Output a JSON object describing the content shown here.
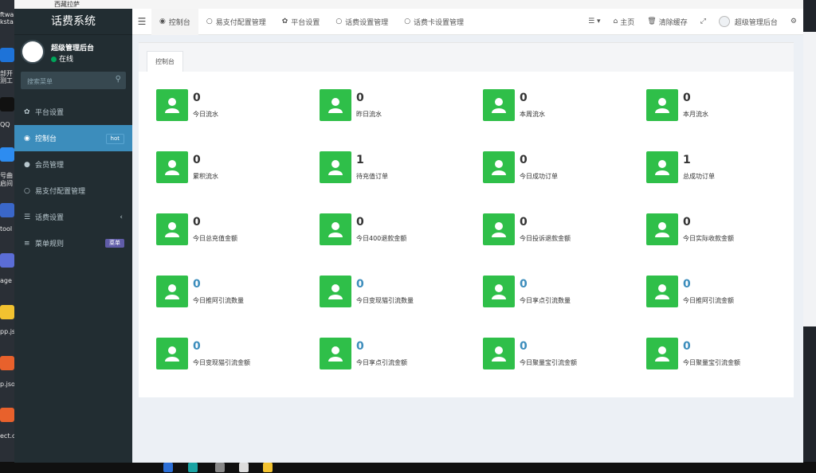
{
  "desktop": {
    "top_label": "西藏拉萨",
    "left_labels": [
      "ftwar",
      "ksta",
      "部开",
      "测工",
      "QQ",
      "号曲",
      "启间",
      "tool",
      "age",
      "pp.js",
      "p.jso",
      "ect.c"
    ]
  },
  "sidebar": {
    "brand": "话费系统",
    "user": {
      "name": "超级管理后台",
      "status": "在线"
    },
    "search": {
      "placeholder": "搜索菜单"
    },
    "items": [
      {
        "icon": "gear-icon",
        "glyph": "✿",
        "label": "平台设置"
      },
      {
        "icon": "dashboard-icon",
        "glyph": "◉",
        "label": "控制台",
        "badge": "hot"
      },
      {
        "icon": "user-circle-icon",
        "glyph": "●",
        "label": "会员管理"
      },
      {
        "icon": "circle-icon",
        "glyph": "○",
        "label": "易支付配置管理"
      },
      {
        "icon": "list-icon",
        "glyph": "☰",
        "label": "话费设置",
        "chevron": "‹"
      },
      {
        "icon": "menu-icon",
        "glyph": "≡",
        "label": "菜单规则",
        "badge": "菜单"
      }
    ]
  },
  "topnav": {
    "tabs": [
      {
        "icon": "dashboard-icon",
        "glyph": "◉",
        "label": "控制台"
      },
      {
        "icon": "circle-icon",
        "glyph": "○",
        "label": "易支付配置管理"
      },
      {
        "icon": "gear-icon",
        "glyph": "✿",
        "label": "平台设置"
      },
      {
        "icon": "circle-icon",
        "glyph": "○",
        "label": "话费设置管理"
      },
      {
        "icon": "circle-icon",
        "glyph": "○",
        "label": "话费卡设置管理"
      }
    ],
    "right": {
      "home": "主页",
      "clear_cache": "清除缓存",
      "admin": "超级管理后台"
    }
  },
  "content": {
    "tab_label": "控制台",
    "stats": [
      {
        "value": "0",
        "label": "今日流水"
      },
      {
        "value": "0",
        "label": "昨日流水"
      },
      {
        "value": "0",
        "label": "本周流水"
      },
      {
        "value": "0",
        "label": "本月流水"
      },
      {
        "value": "0",
        "label": "累积流水"
      },
      {
        "value": "1",
        "label": "待充值订单"
      },
      {
        "value": "0",
        "label": "今日成功订单"
      },
      {
        "value": "1",
        "label": "总成功订单"
      },
      {
        "value": "0",
        "label": "今日总充值金额"
      },
      {
        "value": "0",
        "label": "今日400退款金额"
      },
      {
        "value": "0",
        "label": "今日投诉退款金额"
      },
      {
        "value": "0",
        "label": "今日实际收款金额"
      },
      {
        "value": "0",
        "label": "今日推阿引流数量",
        "blue": true
      },
      {
        "value": "0",
        "label": "今日变现猫引流数量",
        "blue": true
      },
      {
        "value": "0",
        "label": "今日享点引流数量",
        "blue": true
      },
      {
        "value": "0",
        "label": "今日推阿引流金额",
        "blue": true
      },
      {
        "value": "0",
        "label": "今日变现猫引流金额",
        "blue": true
      },
      {
        "value": "0",
        "label": "今日享点引流金额",
        "blue": true
      },
      {
        "value": "0",
        "label": "今日聚量宝引流金额",
        "blue": true
      },
      {
        "value": "0",
        "label": "今日聚量宝引流金额",
        "blue": true
      }
    ]
  }
}
